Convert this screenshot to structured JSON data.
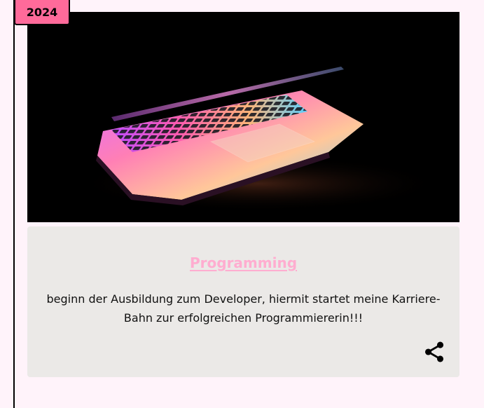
{
  "timeline": {
    "year": "2024"
  },
  "card": {
    "image": {
      "icon": "laptop-photo",
      "colors": {
        "background": "#000000",
        "glow": [
          "#ff5ca8",
          "#b55cff",
          "#5cc8ff",
          "#ffb36b"
        ]
      }
    },
    "title": "Programming",
    "description": "beginn der Ausbildung zum Developer, hiermit startet meine Karriere-Bahn zur erfolgreichen Programmiererin!!!",
    "share_icon": "share-icon"
  },
  "colors": {
    "page_background": "#fff3fa",
    "badge": "#ff6a9a",
    "card_background": "#ebe9e7",
    "title": "#ffadd0"
  }
}
